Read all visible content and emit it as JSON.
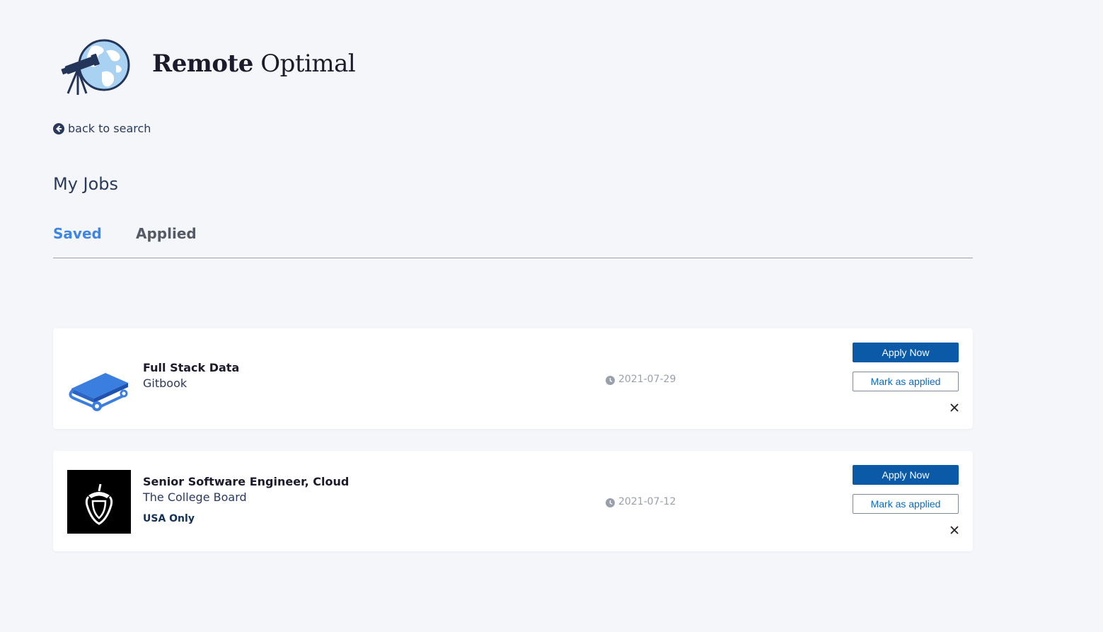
{
  "brand": {
    "name_bold": "Remote",
    "name_light": "Optimal",
    "logo_icon": "telescope-globe-icon"
  },
  "nav": {
    "back_label": "back to search",
    "back_icon": "arrow-left-circle-icon"
  },
  "page": {
    "title": "My Jobs"
  },
  "tabs": [
    {
      "label": "Saved",
      "active": true
    },
    {
      "label": "Applied",
      "active": false
    }
  ],
  "jobs": [
    {
      "title": "Full Stack Data",
      "company": "Gitbook",
      "region": "",
      "date": "2021-07-29",
      "logo": "gitbook-book-icon",
      "apply_label": "Apply Now",
      "mark_label": "Mark as applied"
    },
    {
      "title": "Senior Software Engineer, Cloud",
      "company": "The College Board",
      "region": "USA Only",
      "date": "2021-07-12",
      "logo": "acorn-icon",
      "apply_label": "Apply Now",
      "mark_label": "Mark as applied"
    }
  ],
  "colors": {
    "background": "#f4f6fa",
    "accent": "#3d86e6",
    "button_primary": "#0b5aa7",
    "text_dark": "#1b1b2b"
  }
}
